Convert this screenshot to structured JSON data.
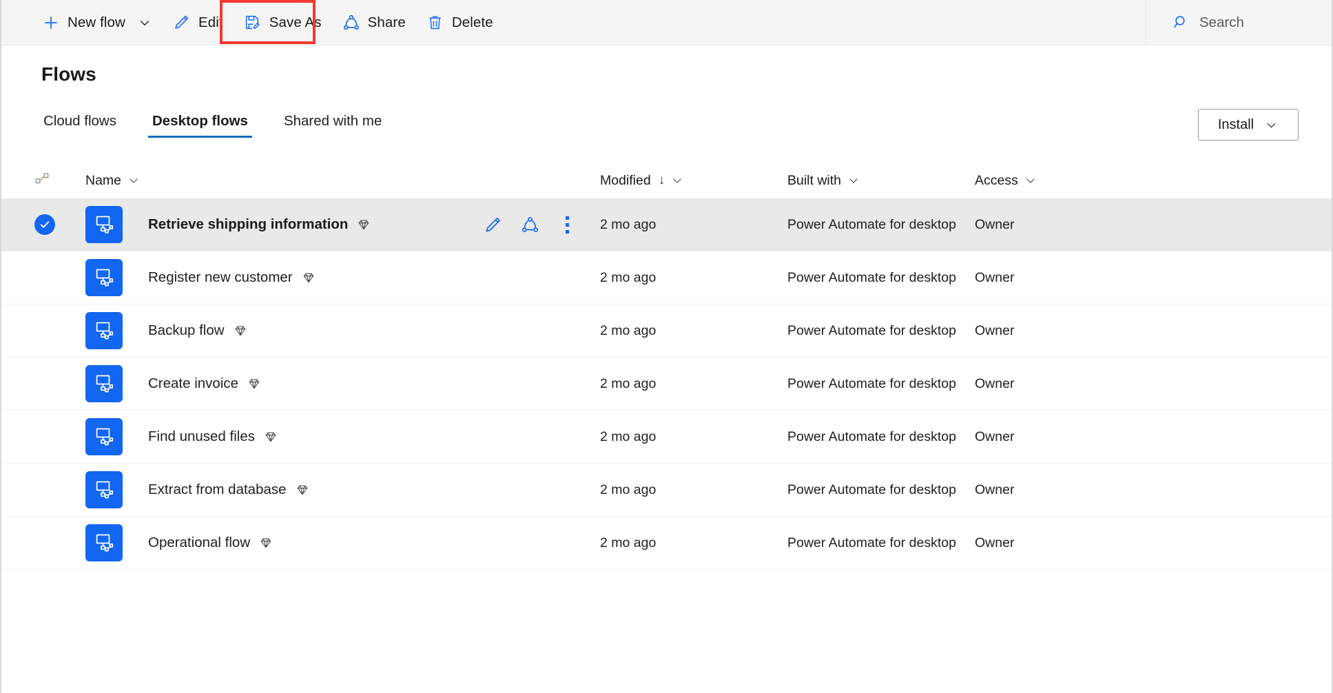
{
  "commandbar": {
    "buttons": [
      {
        "label": "New flow",
        "icon": "plus-icon",
        "has_chevron": true
      },
      {
        "label": "Edit",
        "icon": "pencil-icon",
        "has_chevron": false
      },
      {
        "label": "Save As",
        "icon": "save-as-icon",
        "has_chevron": false,
        "highlighted": true
      },
      {
        "label": "Share",
        "icon": "share-icon",
        "has_chevron": false
      },
      {
        "label": "Delete",
        "icon": "trash-icon",
        "has_chevron": false
      }
    ],
    "search": {
      "label": "Search",
      "icon": "search-icon"
    },
    "highlight_color": "#f23b30"
  },
  "header": {
    "title": "Flows",
    "install": {
      "label": "Install",
      "icon": "chevron-down-icon"
    }
  },
  "tabs": [
    {
      "label": "Cloud flows",
      "active": false
    },
    {
      "label": "Desktop flows",
      "active": true
    },
    {
      "label": "Shared with me",
      "active": false
    }
  ],
  "table": {
    "columns": {
      "flag": {
        "icon": "flow-connection-icon"
      },
      "name": {
        "label": "Name",
        "icon": "chevron-down-icon"
      },
      "modified": {
        "label": "Modified",
        "sort": "↓",
        "icon": "chevron-down-icon"
      },
      "built_with": {
        "label": "Built with",
        "icon": "chevron-down-icon"
      },
      "access": {
        "label": "Access",
        "icon": "chevron-down-icon"
      }
    },
    "rows": [
      {
        "name": "Retrieve shipping information",
        "premium": true,
        "modified": "2 mo ago",
        "built_with": "Power Automate for desktop",
        "access": "Owner",
        "selected": true,
        "actions": [
          "pencil-icon",
          "share-icon",
          "more-vertical-icon"
        ]
      },
      {
        "name": "Register new customer",
        "premium": true,
        "modified": "2 mo ago",
        "built_with": "Power Automate for desktop",
        "access": "Owner",
        "selected": false,
        "actions": []
      },
      {
        "name": "Backup flow",
        "premium": true,
        "modified": "2 mo ago",
        "built_with": "Power Automate for desktop",
        "access": "Owner",
        "selected": false,
        "actions": []
      },
      {
        "name": "Create invoice",
        "premium": true,
        "modified": "2 mo ago",
        "built_with": "Power Automate for desktop",
        "access": "Owner",
        "selected": false,
        "actions": []
      },
      {
        "name": "Find unused files",
        "premium": true,
        "modified": "2 mo ago",
        "built_with": "Power Automate for desktop",
        "access": "Owner",
        "selected": false,
        "actions": []
      },
      {
        "name": "Extract from database",
        "premium": true,
        "modified": "2 mo ago",
        "built_with": "Power Automate for desktop",
        "access": "Owner",
        "selected": false,
        "actions": []
      },
      {
        "name": "Operational flow",
        "premium": true,
        "modified": "2 mo ago",
        "built_with": "Power Automate for desktop",
        "access": "Owner",
        "selected": false,
        "actions": []
      }
    ]
  },
  "colors": {
    "accent": "#1266f1",
    "tab_underline": "#0f6cbd",
    "selected_row_bg": "#e9e9e9",
    "commandbar_bg": "#f5f5f5",
    "highlight_box": "#f23b30"
  }
}
